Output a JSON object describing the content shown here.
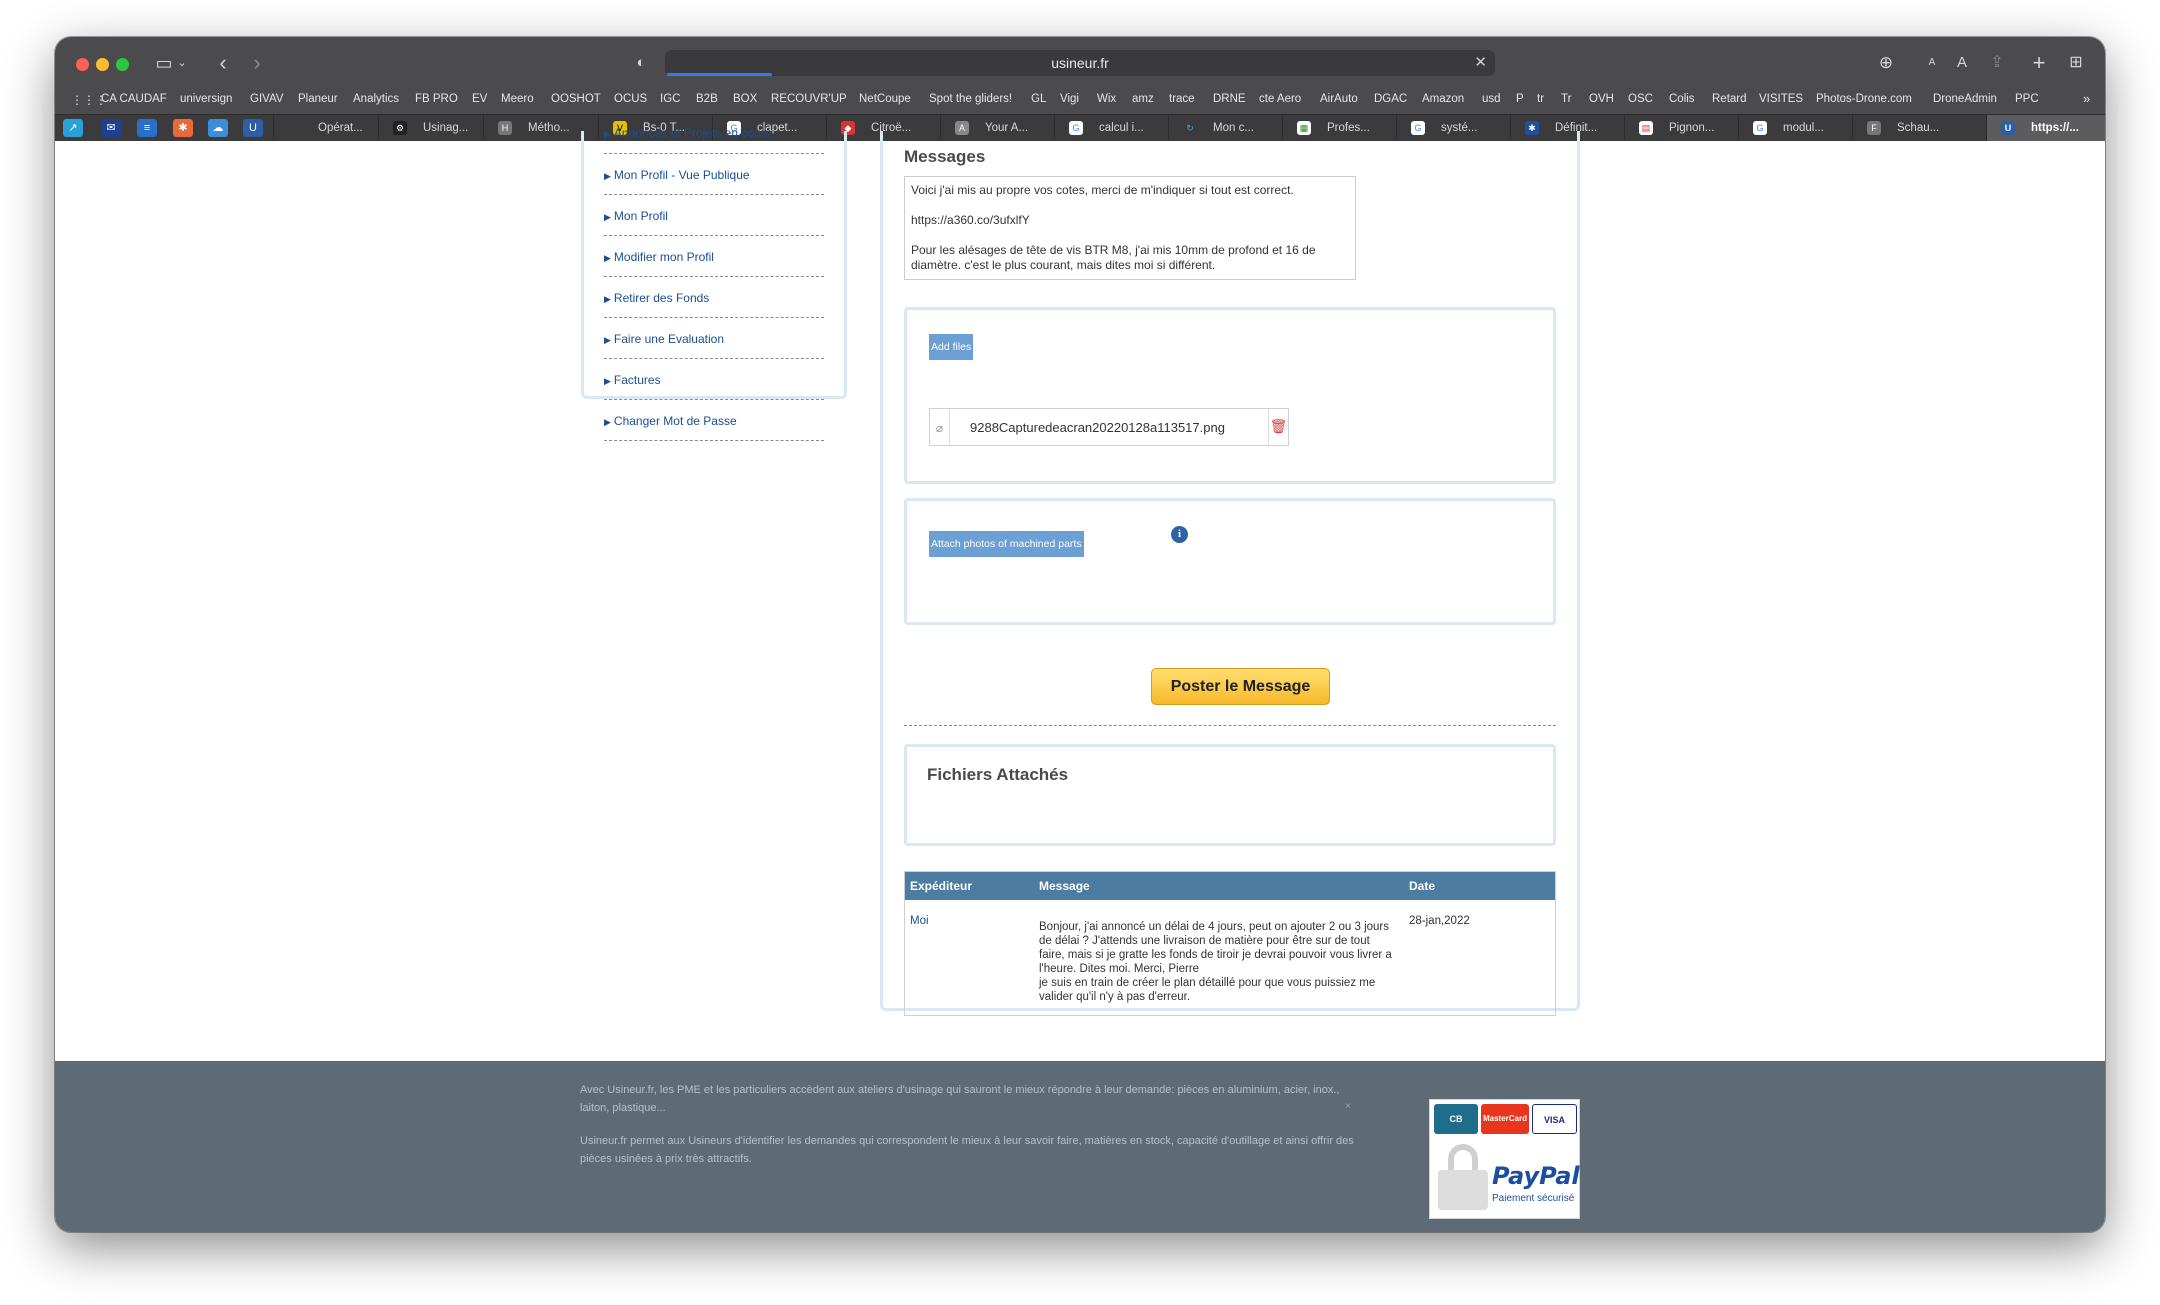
{
  "browser": {
    "url": "usineur.fr",
    "bookmarks": [
      "CA CAUDAF",
      "universign",
      "GIVAV",
      "Planeur",
      "Analytics",
      "FB PRO",
      "EV",
      "Meero",
      "OOSHOT",
      "OCUS",
      "IGC",
      "B2B",
      "BOX",
      "RECOUVR'UP",
      "NetCoupe",
      "Spot the gliders!",
      "GL",
      "Vigi",
      "Wix",
      "amz",
      "trace",
      "DRNE",
      "cte Aero",
      "AirAuto",
      "DGAC",
      "Amazon",
      "usd",
      "P",
      "tr",
      "Tr",
      "OVH",
      "OSC",
      "Colis",
      "Retard",
      "VISITES",
      "Photos-Drone.com",
      "DroneAdmin",
      "PPC"
    ],
    "tabs": [
      "Opérat...",
      "Usinag...",
      "Métho...",
      "Bs-0 T...",
      "clapet...",
      "Citroë...",
      "Your A...",
      "calcul i...",
      "Mon c...",
      "Profes...",
      "systé...",
      "Définit...",
      "Pignon...",
      "modul...",
      "Schau...",
      "https://..."
    ]
  },
  "sidebar": {
    "items": [
      "Annonces et Projets en cours",
      "Mon Profil - Vue Publique",
      "Mon Profil",
      "Modifier mon Profil",
      "Retirer des Fonds",
      "Faire une Evaluation",
      "Factures",
      "Changer Mot de Passe"
    ]
  },
  "main": {
    "title": "Messages",
    "message_lines": [
      "Voici j'ai mis au propre vos cotes, merci de m'indiquer si tout est correct.",
      "https://a360.co/3ufxlfY",
      "Pour les alésages de tête de vis BTR M8, j'ai mis 10mm de profond et 16 de diamètre. c'est le plus courant, mais dites moi si différent."
    ],
    "add_files_label": "Add files",
    "attached_file": "9288Capturedeacran20220128a113517.png",
    "attach_photos_label": "Attach photos of machined parts",
    "post_button": "Poster le Message",
    "fichiers_title": "Fichiers Attachés",
    "table": {
      "headers": [
        "Expéditeur",
        "Message",
        "Date"
      ],
      "rows": [
        {
          "sender": "Moi",
          "message": "Bonjour, j'ai annoncé un délai de 4 jours, peut on ajouter 2 ou 3 jours de délai ? J'attends une livraison de matière pour être sur de tout faire, mais si je gratte les fonds de tiroir je devrai pouvoir vous livrer a l'heure. Dites moi. Merci, Pierre",
          "message2": "je suis en train de créer le plan détaillé pour que vous puissiez me valider qu'il n'y à pas d'erreur.",
          "date": "28-jan,2022"
        }
      ]
    }
  },
  "footer": {
    "para1": "Avec Usineur.fr, les PME et les particuliers accèdent aux ateliers d'usinage qui sauront le mieux répondre à leur demande: pièces en aluminium, acier, inox., laiton, plastique...",
    "para2": "Usineur.fr permet aux Usineurs d'identifier les demandes qui correspondent le mieux à leur savoir faire, matières en stock, capacité d'outillage et ainsi offrir des pièces usinées à prix très attractifs.",
    "close_mark": "×",
    "cards": [
      "CB",
      "MasterCard",
      "VISA"
    ],
    "paypal": "PayPal",
    "paypal_sub": "Paiement sécurisé"
  }
}
